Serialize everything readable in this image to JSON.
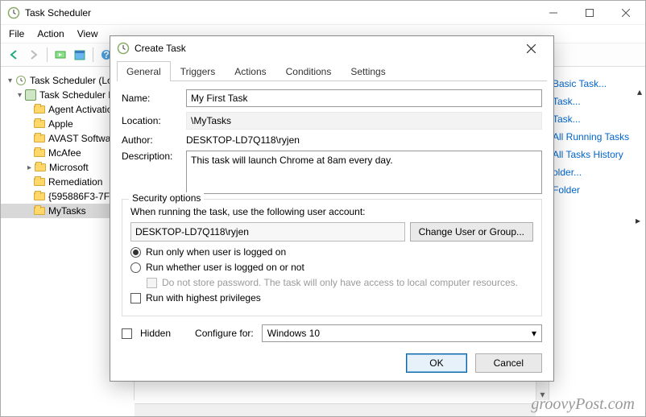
{
  "main": {
    "title": "Task Scheduler",
    "menubar": [
      "File",
      "Action",
      "View"
    ],
    "tree": {
      "root": "Task Scheduler (Local",
      "library": "Task Scheduler Lib",
      "items": [
        "Agent Activatio",
        "Apple",
        "AVAST Software",
        "McAfee",
        "Microsoft",
        "Remediation",
        "{595886F3-7FE",
        "MyTasks"
      ]
    },
    "actions": {
      "items": [
        "Basic Task...",
        "Task...",
        "Task...",
        "All Running Tasks",
        "All Tasks History",
        "older...",
        "Folder"
      ]
    }
  },
  "dialog": {
    "title": "Create Task",
    "tabs": [
      "General",
      "Triggers",
      "Actions",
      "Conditions",
      "Settings"
    ],
    "labels": {
      "name": "Name:",
      "location": "Location:",
      "author": "Author:",
      "description": "Description:"
    },
    "name_value": "My First Task",
    "location_value": "\\MyTasks",
    "author_value": "DESKTOP-LD7Q118\\ryjen",
    "description_value": "This task will launch Chrome at 8am every day.",
    "security": {
      "legend": "Security options",
      "prompt": "When running the task, use the following user account:",
      "account": "DESKTOP-LD7Q118\\ryjen",
      "change_btn": "Change User or Group...",
      "radio1": "Run only when user is logged on",
      "radio2": "Run whether user is logged on or not",
      "nostore": "Do not store password.  The task will only have access to local computer resources.",
      "highest": "Run with highest privileges"
    },
    "hidden_label": "Hidden",
    "configure_label": "Configure for:",
    "configure_value": "Windows 10",
    "ok": "OK",
    "cancel": "Cancel"
  },
  "watermark": "groovyPost.com"
}
